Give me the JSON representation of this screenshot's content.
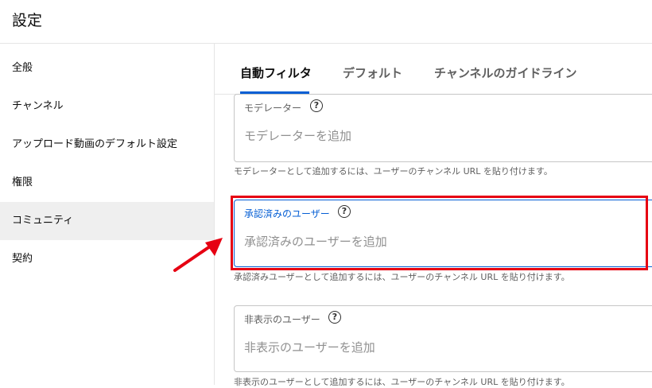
{
  "header": {
    "title": "設定"
  },
  "sidebar": {
    "items": [
      {
        "label": "全般"
      },
      {
        "label": "チャンネル"
      },
      {
        "label": "アップロード動画のデフォルト設定"
      },
      {
        "label": "権限"
      },
      {
        "label": "コミュニティ"
      },
      {
        "label": "契約"
      }
    ],
    "active_index": 4
  },
  "tabs": [
    {
      "label": "自動フィルタ"
    },
    {
      "label": "デフォルト"
    },
    {
      "label": "チャンネルのガイドライン"
    }
  ],
  "fields": {
    "moderators": {
      "label": "モデレーター",
      "placeholder": "モデレーターを追加",
      "hint": "モデレーターとして追加するには、ユーザーのチャンネル URL を貼り付けます。"
    },
    "approved_users": {
      "label": "承認済みのユーザー",
      "placeholder": "承認済みのユーザーを追加",
      "hint": "承認済みユーザーとして追加するには、ユーザーのチャンネル URL を貼り付けます。"
    },
    "hidden_users": {
      "label": "非表示のユーザー",
      "placeholder": "非表示のユーザーを追加",
      "hint": "非表示のユーザーとして追加するには、ユーザーのチャンネル URL を貼り付けます。"
    }
  },
  "icons": {
    "help": "help-circle-icon",
    "annotation": "red-arrow-icon"
  },
  "colors": {
    "accent": "#065fd4",
    "annotation": "#e60012"
  }
}
